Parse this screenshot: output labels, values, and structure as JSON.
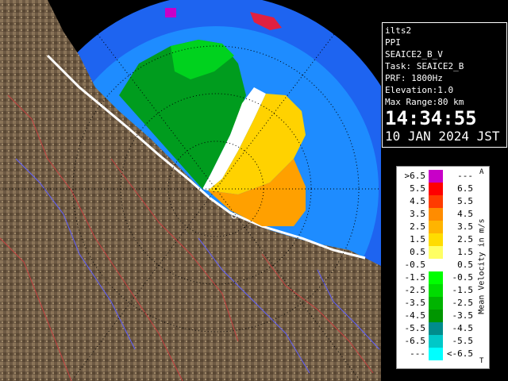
{
  "station": {
    "name": "ilts2",
    "scan_mode": "PPI",
    "product": "SEAICE2_B_V",
    "task": "Task: SEAICE2_B",
    "prf": "PRF: 1800Hz",
    "elevation": "Elevation:1.0",
    "max_range": "Max Range:80 km",
    "time": "14:34:55",
    "date": "10 JAN 2024 JST"
  },
  "legend": {
    "unit": "Mean Velocity in m/s",
    "top_mark": "A",
    "bottom_mark": "T",
    "rows": [
      {
        "lo": ">6.5",
        "hi": "---",
        "color": "#c800c8"
      },
      {
        "lo": "5.5",
        "hi": "6.5",
        "color": "#ff0000"
      },
      {
        "lo": "4.5",
        "hi": "5.5",
        "color": "#ff3c00"
      },
      {
        "lo": "3.5",
        "hi": "4.5",
        "color": "#ff8c00"
      },
      {
        "lo": "2.5",
        "hi": "3.5",
        "color": "#ffb400"
      },
      {
        "lo": "1.5",
        "hi": "2.5",
        "color": "#ffdc00"
      },
      {
        "lo": "0.5",
        "hi": "1.5",
        "color": "#ffff64"
      },
      {
        "lo": "-0.5",
        "hi": "0.5",
        "color": "#ffffff"
      },
      {
        "lo": "-1.5",
        "hi": "-0.5",
        "color": "#00ff00"
      },
      {
        "lo": "-2.5",
        "hi": "-1.5",
        "color": "#00dc00"
      },
      {
        "lo": "-3.5",
        "hi": "-2.5",
        "color": "#00b400"
      },
      {
        "lo": "-4.5",
        "hi": "-3.5",
        "color": "#009600"
      },
      {
        "lo": "-5.5",
        "hi": "-4.5",
        "color": "#008c8c"
      },
      {
        "lo": "-6.5",
        "hi": "-5.5",
        "color": "#00c8c8"
      },
      {
        "lo": "---",
        "hi": "<-6.5",
        "color": "#00ffff"
      }
    ]
  },
  "colors": {
    "background": "#000000",
    "range_circle": "#1e78ff",
    "outer_coverage": "#1e50ff",
    "terrain": "#786450"
  }
}
